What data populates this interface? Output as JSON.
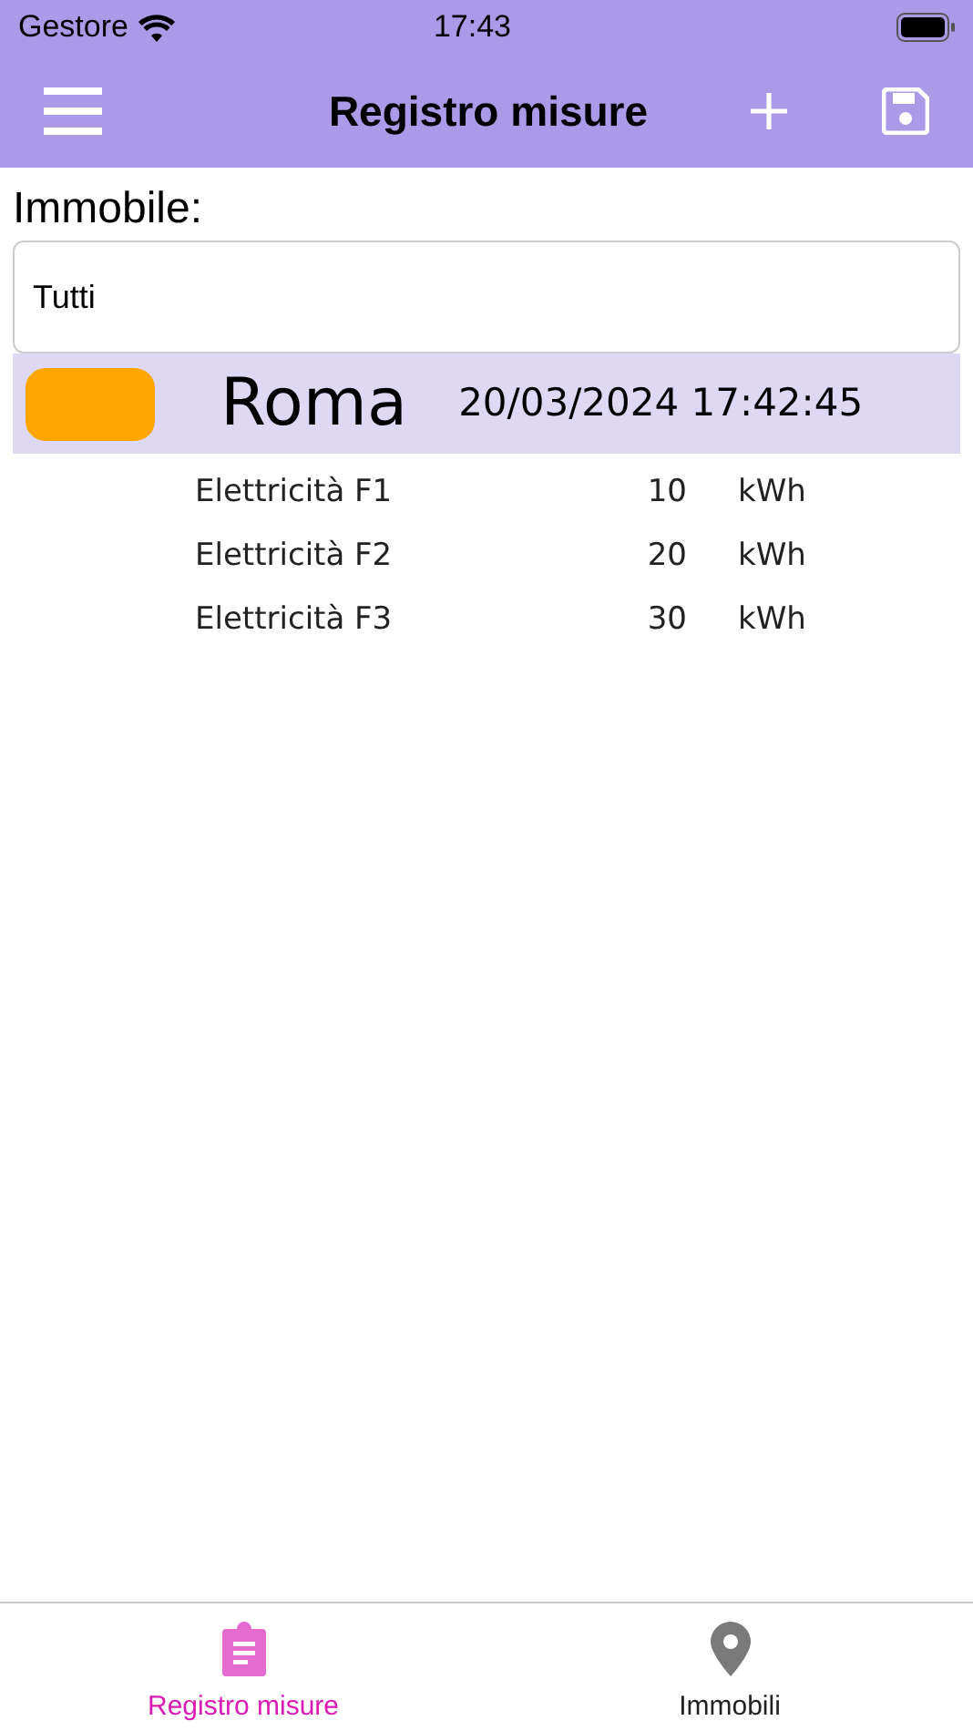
{
  "status_bar": {
    "carrier": "Gestore",
    "time": "17:43"
  },
  "nav_bar": {
    "title": "Registro misure"
  },
  "filter": {
    "label": "Immobile:",
    "value": "Tutti"
  },
  "records": [
    {
      "color": "#ffa500",
      "place": "Roma",
      "timestamp": "20/03/2024 17:42:45",
      "readings": [
        {
          "name": "Elettricità F1",
          "value": "10",
          "unit": "kWh"
        },
        {
          "name": "Elettricità F2",
          "value": "20",
          "unit": "kWh"
        },
        {
          "name": "Elettricità F3",
          "value": "30",
          "unit": "kWh"
        }
      ]
    }
  ],
  "tabs": [
    {
      "label": "Registro misure",
      "kind": "clipboard",
      "selected": true
    },
    {
      "label": "Immobili",
      "kind": "pin",
      "selected": false
    }
  ]
}
